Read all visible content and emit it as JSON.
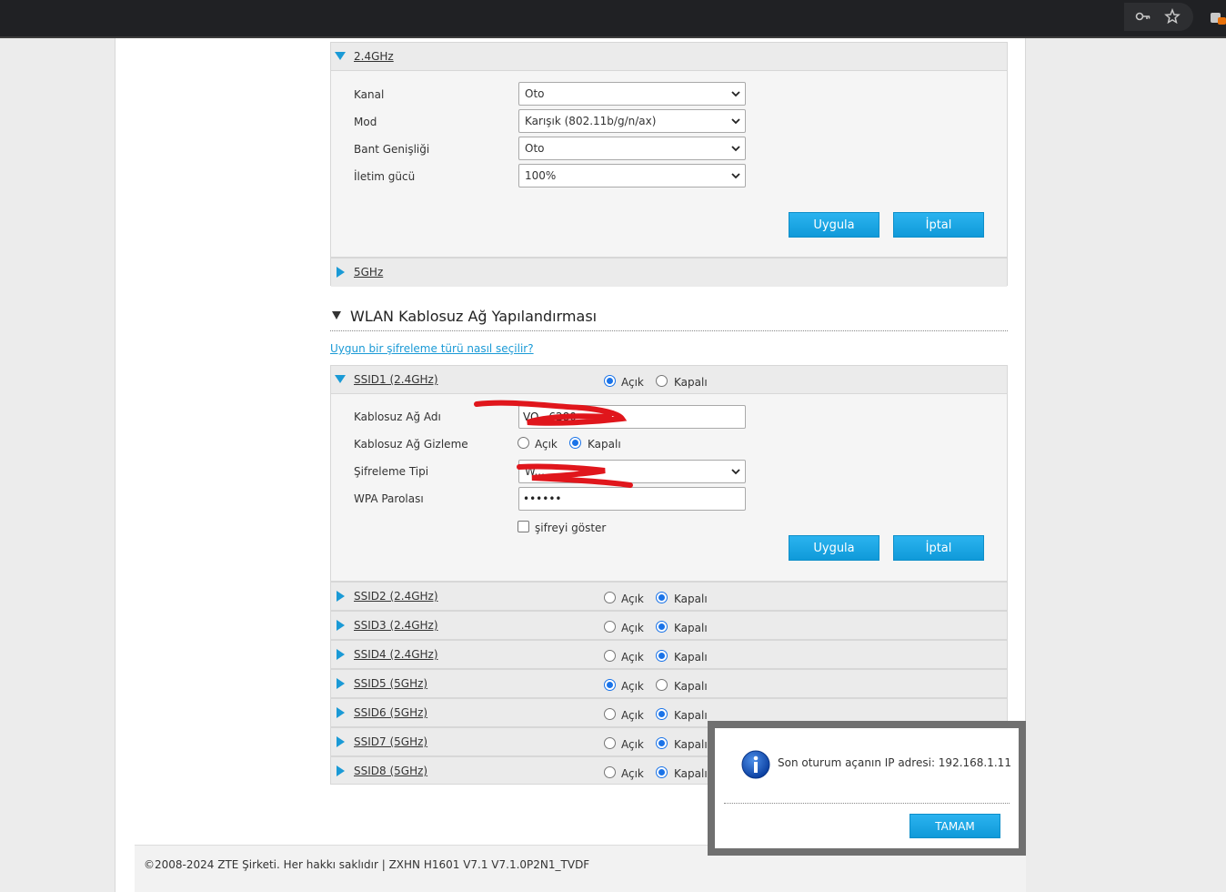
{
  "band24": {
    "title": "2.4GHz",
    "fields": [
      {
        "label": "Kanal",
        "value": "Oto"
      },
      {
        "label": "Mod",
        "value": "Karışık (802.11b/g/n/ax)"
      },
      {
        "label": "Bant Genişliği",
        "value": "Oto"
      },
      {
        "label": "İletim gücü",
        "value": "100%"
      }
    ],
    "apply_label": "Uygula",
    "cancel_label": "İptal"
  },
  "band5": {
    "title": "5GHz"
  },
  "wlan": {
    "title": "WLAN Kablosuz Ağ Yapılandırması",
    "help_link": "Uygun bir şifreleme türü nasıl seçilir?",
    "on_label": "Açık",
    "off_label": "Kapalı",
    "ssid1": {
      "title": "SSID1 (2.4GHz)",
      "enabled": true,
      "ssid_label": "Kablosuz Ağ Adı",
      "ssid_value": "VO...6280",
      "hide_label": "Kablosuz Ağ Gizleme",
      "hide_on": false,
      "enc_label": "Şifreleme Tipi",
      "enc_value": "W...",
      "pwd_label": "WPA Parolası",
      "pwd_value": "••••••",
      "show_pwd_label": "şifreyi göster",
      "apply_label": "Uygula",
      "cancel_label": "İptal"
    },
    "ssids": [
      {
        "title": "SSID2 (2.4GHz)",
        "enabled": false
      },
      {
        "title": "SSID3 (2.4GHz)",
        "enabled": false
      },
      {
        "title": "SSID4 (2.4GHz)",
        "enabled": false
      },
      {
        "title": "SSID5 (5GHz)",
        "enabled": true
      },
      {
        "title": "SSID6 (5GHz)",
        "enabled": false
      },
      {
        "title": "SSID7 (5GHz)",
        "enabled": false
      },
      {
        "title": "SSID8 (5GHz)",
        "enabled": false
      }
    ]
  },
  "footer": {
    "text": "©2008-2024 ZTE Şirketi. Her hakkı saklıdır  |   ZXHN H1601 V7.1 V7.1.0P2N1_TVDF"
  },
  "dialog": {
    "message": "Son oturum açanın IP adresi: 192.168.1.11",
    "ok_label": "TAMAM"
  },
  "colors": {
    "accent": "#1a9ad6",
    "button": "#13a3e2",
    "topbar": "#202124"
  }
}
